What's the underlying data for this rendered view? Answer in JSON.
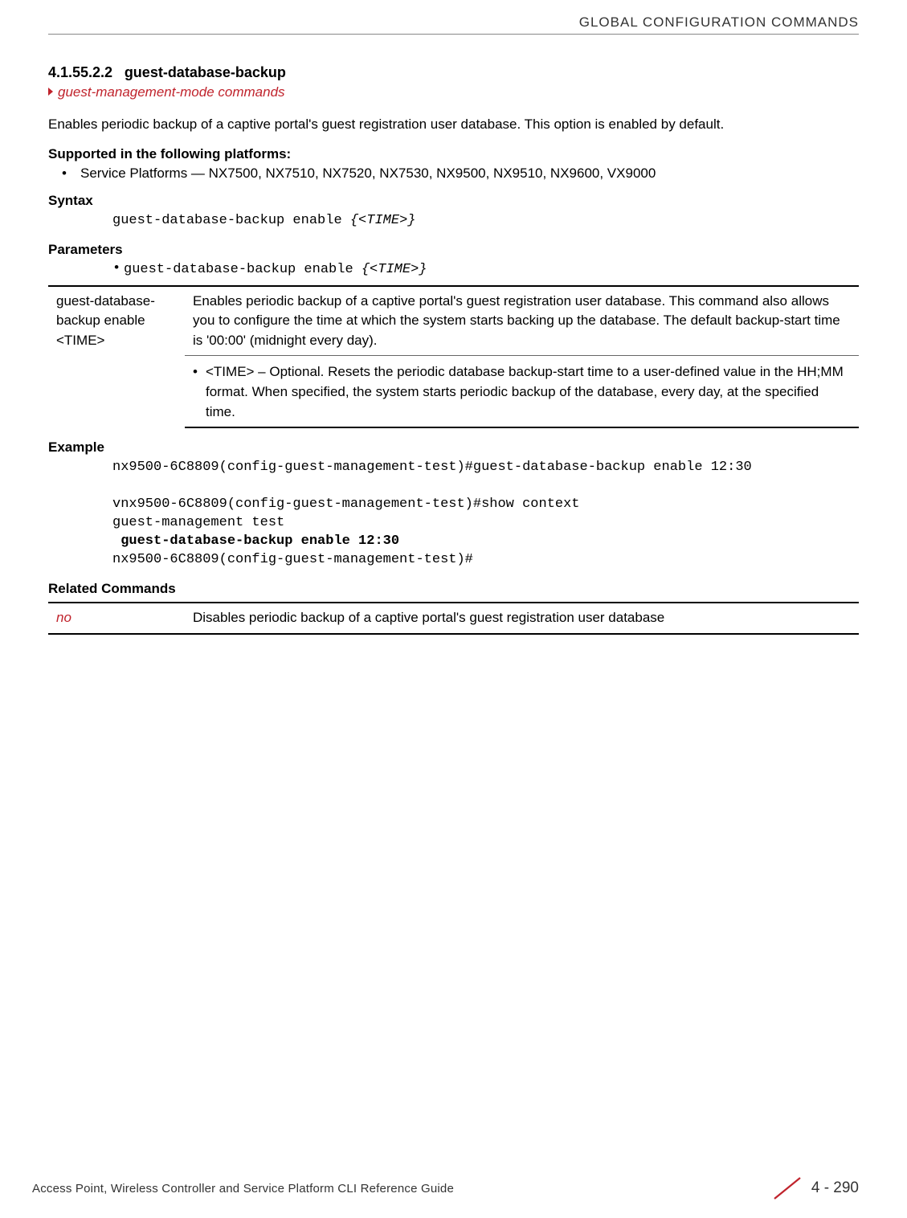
{
  "header": {
    "chapter": "GLOBAL CONFIGURATION COMMANDS"
  },
  "section": {
    "number": "4.1.55.2.2",
    "title": "guest-database-backup",
    "sublink": "guest-management-mode commands",
    "intro": "Enables periodic backup of a captive portal's guest registration user database. This option is enabled by default."
  },
  "supported": {
    "heading": "Supported in the following platforms:",
    "bullet": "Service Platforms — NX7500, NX7510, NX7520, NX7530, NX9500, NX9510, NX9600, VX9000"
  },
  "syntax": {
    "heading": "Syntax",
    "code_plain": "guest-database-backup enable ",
    "code_italic": "{<TIME>}"
  },
  "parameters": {
    "heading": "Parameters",
    "bullet_plain": "guest-database-backup enable ",
    "bullet_italic": "{<TIME>}",
    "table_left": "guest-database-backup enable <TIME>",
    "table_row1_right": "Enables periodic backup of a captive portal's guest registration user database. This command also allows you to configure the time at which the system starts backing up the database. The default backup-start time is '00:00' (midnight every day).",
    "table_row2_bullet": "<TIME> – Optional. Resets the periodic database backup-start time to a user-defined value in the HH;MM format. When specified, the system starts periodic backup of the database, every day, at the specified time."
  },
  "example": {
    "heading": "Example",
    "line1": "nx9500-6C8809(config-guest-management-test)#guest-database-backup enable 12:30",
    "line2": "",
    "line3": "vnx9500-6C8809(config-guest-management-test)#show context",
    "line4": "guest-management test",
    "line5_bold": " guest-database-backup enable 12:30",
    "line6": "nx9500-6C8809(config-guest-management-test)#"
  },
  "related": {
    "heading": "Related Commands",
    "left": "no",
    "right": "Disables periodic backup of a captive portal's guest registration user database"
  },
  "footer": {
    "title": "Access Point, Wireless Controller and Service Platform CLI Reference Guide",
    "page": "4 - 290"
  }
}
